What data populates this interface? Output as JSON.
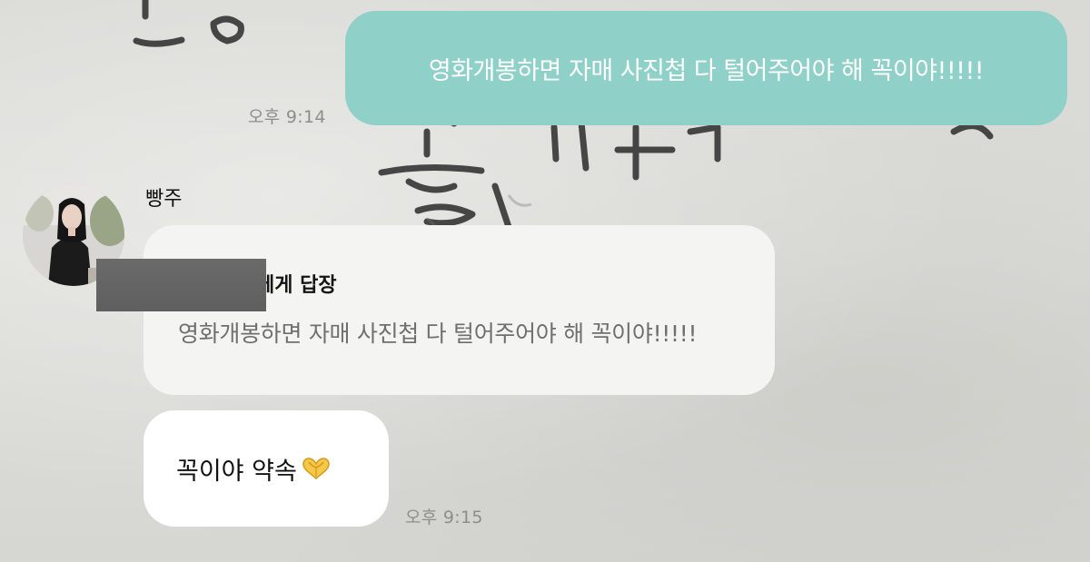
{
  "conversation": {
    "outgoing": {
      "text": "영화개봉하면 자매 사진첩 다 털어주어야 해 꼭이야!!!!!",
      "time": "오후 9:14"
    },
    "incoming": {
      "sender_name": "빵주",
      "reply_title": "에게 답장",
      "reply_quote": "영화개봉하면 자매 사진첩 다 털어주어야 해 꼭이야!!!!!",
      "message_text": "꼭이야 약속",
      "message_emoji": "heart-hands-icon",
      "time": "오후 9:15"
    }
  },
  "colors": {
    "outgoing_bubble": "#8fd0c8",
    "reply_bubble": "#f4f4f3",
    "incoming_bubble": "#ffffff",
    "timestamp": "#8d8d8a"
  }
}
